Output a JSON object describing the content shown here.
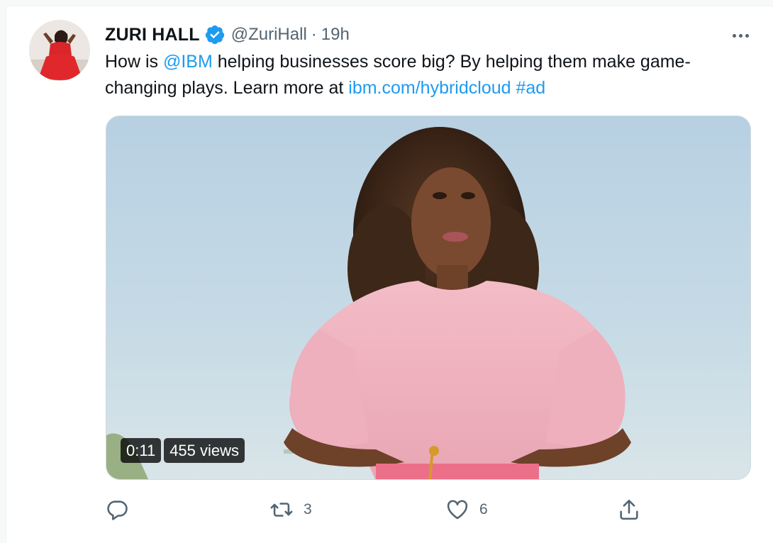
{
  "tweet": {
    "author_name": "ZURI HALL",
    "verified": true,
    "handle": "@ZuriHall",
    "separator": "·",
    "time": "19h",
    "text": {
      "part1": "How is ",
      "mention": "@IBM",
      "part2": " helping businesses score big? By helping them make game-changing plays. Learn more at ",
      "url": "ibm.com/hybridcloud",
      "space": " ",
      "hashtag": "#ad"
    }
  },
  "media": {
    "type": "video",
    "duration": "0:11",
    "views": "455 views"
  },
  "actions": {
    "reply_count": "",
    "retweet_count": "3",
    "like_count": "6"
  },
  "colors": {
    "link": "#1d9bf0",
    "verified_badge": "#1d9bf0",
    "secondary_text": "#536471"
  },
  "icons": [
    "verified-badge-icon",
    "more-options-icon",
    "reply-icon",
    "retweet-icon",
    "like-icon",
    "share-icon"
  ]
}
